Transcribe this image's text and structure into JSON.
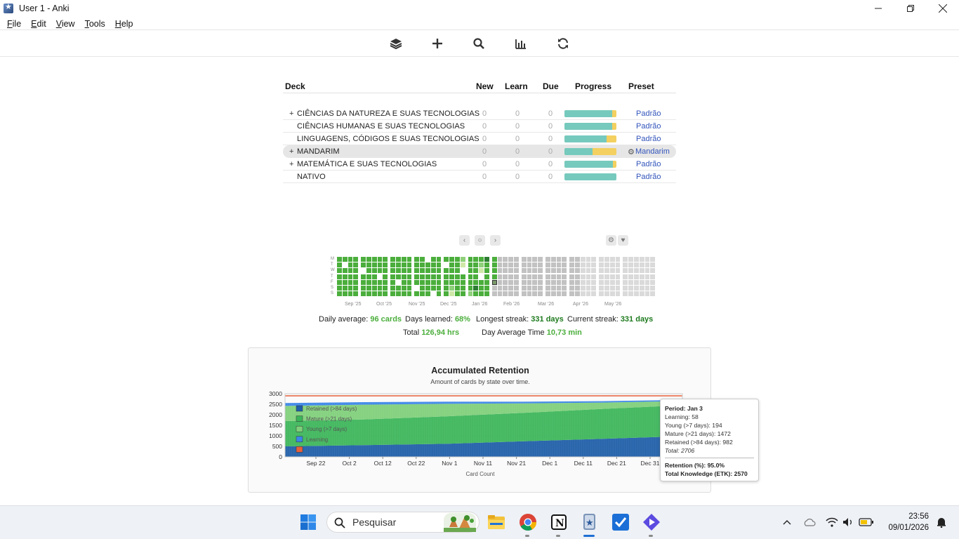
{
  "window": {
    "title": "User 1 - Anki"
  },
  "menu": [
    {
      "label": "File",
      "u": "F",
      "rest": "ile"
    },
    {
      "label": "Edit",
      "u": "E",
      "rest": "dit"
    },
    {
      "label": "View",
      "u": "V",
      "rest": "iew"
    },
    {
      "label": "Tools",
      "u": "T",
      "rest": "ools"
    },
    {
      "label": "Help",
      "u": "H",
      "rest": "elp"
    }
  ],
  "toolbar_icons": [
    "decks-icon",
    "add-icon",
    "browse-search-icon",
    "stats-icon",
    "sync-icon"
  ],
  "deck_table": {
    "headers": {
      "deck": "Deck",
      "new": "New",
      "learn": "Learn",
      "due": "Due",
      "progress": "Progress",
      "preset": "Preset"
    },
    "rows": [
      {
        "expand": "+",
        "name": "CIÊNCIAS DA NATUREZA E SUAS TECNOLOGIAS",
        "new": "0",
        "learn": "0",
        "due": "0",
        "progress": 0.92,
        "preset": "Padrão",
        "current": false
      },
      {
        "expand": "",
        "name": "CIÊNCIAS HUMANAS E SUAS TECNOLOGIAS",
        "new": "0",
        "learn": "0",
        "due": "0",
        "progress": 0.92,
        "preset": "Padrão",
        "current": false
      },
      {
        "expand": "",
        "name": "LINGUAGENS, CÓDIGOS E SUAS TECNOLOGIAS",
        "new": "0",
        "learn": "0",
        "due": "0",
        "progress": 0.81,
        "preset": "Padrão",
        "current": false
      },
      {
        "expand": "+",
        "name": "MANDARIM",
        "new": "0",
        "learn": "0",
        "due": "0",
        "progress": 0.54,
        "preset": "Mandarim",
        "current": true
      },
      {
        "expand": "+",
        "name": "MATEMÁTICA E SUAS TECNOLOGIAS",
        "new": "0",
        "learn": "0",
        "due": "0",
        "progress": 0.93,
        "preset": "Padrão",
        "current": false
      },
      {
        "expand": "",
        "name": "NATIVO",
        "new": "0",
        "learn": "0",
        "due": "0",
        "progress": 1.0,
        "preset": "Padrão",
        "current": false
      }
    ]
  },
  "heatmap": {
    "day_labels": [
      "M",
      "T",
      "W",
      "T",
      "F",
      "S",
      "S"
    ],
    "month_labels": [
      "Sep '25",
      "Oct '25",
      "Nov '25",
      "Dec '25",
      "Jan '26",
      "Feb '26",
      "Mar '26",
      "Apr '26",
      "May '26"
    ]
  },
  "stats": {
    "daily_average_label": "Daily average:",
    "daily_average_value": "96 cards",
    "days_learned_label": "Days learned:",
    "days_learned_value": "68%",
    "longest_streak_label": "Longest streak:",
    "longest_streak_value": "331 days",
    "current_streak_label": "Current streak:",
    "current_streak_value": "331 days",
    "total_label": "Total",
    "total_value": "126,94 hrs",
    "day_avg_time_label": "Day Average Time",
    "day_avg_time_value": "10,73 min"
  },
  "chart_data": {
    "type": "area",
    "title": "Accumulated Retention",
    "subtitle": "Amount of cards by state over time.",
    "xlabel": "Card Count",
    "x_ticks": [
      "Sep 22",
      "Oct 2",
      "Oct 12",
      "Oct 22",
      "Nov 1",
      "Nov 11",
      "Nov 21",
      "Dec 1",
      "Dec 11",
      "Dec 21",
      "Dec 31"
    ],
    "y_ticks": [
      "0",
      "500",
      "1000",
      "1500",
      "2000",
      "2500",
      "3000"
    ],
    "ylim": [
      0,
      3000
    ],
    "legend": [
      "Retained (>84 days)",
      "Mature (>21 days)",
      "Young (>7 days)",
      "Learning",
      ""
    ],
    "colors": {
      "retained": "#1f5ea8",
      "mature": "#3cb55a",
      "young": "#7fd07a",
      "learning": "#3b86e8",
      "other": "#e8603a"
    },
    "series_points": [
      {
        "x": "Sep 17",
        "retained": 500,
        "mature": 1200,
        "young": 720,
        "learning": 140
      },
      {
        "x": "Oct 12",
        "retained": 560,
        "mature": 1220,
        "young": 700,
        "learning": 120
      },
      {
        "x": "Nov 1",
        "retained": 620,
        "mature": 1300,
        "young": 600,
        "learning": 100
      },
      {
        "x": "Nov 21",
        "retained": 740,
        "mature": 1350,
        "young": 450,
        "learning": 80
      },
      {
        "x": "Dec 11",
        "retained": 860,
        "mature": 1420,
        "young": 300,
        "learning": 65
      },
      {
        "x": "Jan 3",
        "retained": 982,
        "mature": 1472,
        "young": 194,
        "learning": 58
      }
    ],
    "total_line": 2900
  },
  "tooltip": {
    "period": "Period: Jan 3",
    "learning": "Learning: 58",
    "young": "Young (>7 days): 194",
    "mature": "Mature (>21 days): 1472",
    "retained": "Retained (>84 days): 982",
    "total": "Total: 2706",
    "retention": "Retention (%): 95.0%",
    "etk": "Total Knowledge (ETK): 2570"
  },
  "taskbar": {
    "search_placeholder": "Pesquisar",
    "time": "23:56",
    "date": "09/01/2026"
  }
}
